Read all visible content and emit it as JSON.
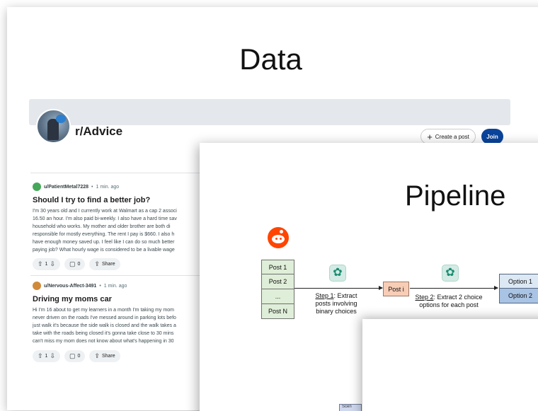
{
  "data_slide": {
    "title": "Data",
    "subreddit": {
      "name": "r/Advice",
      "create_post_label": "Create a post",
      "join_label": "Join"
    },
    "posts": [
      {
        "user": "u/PatientMetal7228",
        "age": "1 min. ago",
        "title": "Should I try to find a better job?",
        "body_lines": [
          "I'm 30 years old and I currently work at Walmart as a cap 2 associ",
          "16.50 an hour. I'm also paid bi-weekly. I also have a hard time sav",
          "household who works. My mother and older brother are both di",
          "responsible for mostly everything. The rent I pay is $660. I also h",
          "have enough money saved up. I feel like I can do so much better",
          "paying job? What hourly wage is considered to be a livable wage"
        ],
        "votes": "1",
        "comments": "0",
        "share_label": "Share"
      },
      {
        "user": "u/Nervous-Affect-3491",
        "age": "1 min. ago",
        "title": "Driving my moms car",
        "body_lines": [
          "Hi I'm 16 about to get my learners in a month I'm taking my mom",
          "never driven on the roads I've messed around in parking lots befo",
          "just walk it's because the side walk is closed and the walk takes a",
          "take with the roads being closed it's gonna take close to 30 mins",
          "can't miss my mom does not know about what's happening in 30"
        ],
        "votes": "1",
        "comments": "0",
        "share_label": "Share"
      }
    ]
  },
  "pipeline_slide": {
    "title": "Pipeline",
    "posts_list": [
      "Post 1",
      "Post 2",
      "...",
      "Post N"
    ],
    "step1": {
      "label": "Step 1",
      "text": ": Extract posts involving binary choices"
    },
    "post_i": "Post i",
    "step2": {
      "label": "Step 2",
      "text": ": Extract 2 choice options for each post"
    },
    "options": [
      "Option 1",
      "Option 2"
    ]
  },
  "peek_label": "Scen",
  "colors": {
    "join_button": "#0a449b",
    "reddit_orange": "#ff4500",
    "posts_fill": "#dfeed8",
    "post_i_fill": "#f8cdb6",
    "option1_fill": "#dde8f5",
    "option2_fill": "#a9c3e4",
    "gpt_icon": "#1a8c72"
  },
  "icons": {
    "reddit": "reddit-alien-icon",
    "gpt": "chatgpt-icon",
    "upvote": "upvote-arrow-icon",
    "downvote": "downvote-arrow-icon",
    "comment": "comment-bubble-icon",
    "share": "share-icon"
  }
}
